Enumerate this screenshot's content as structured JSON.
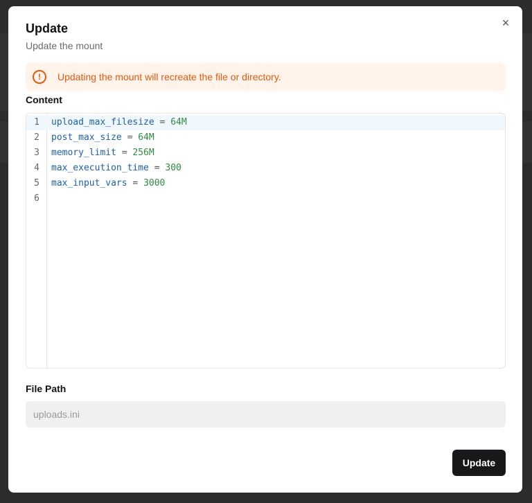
{
  "dialog": {
    "title": "Update",
    "subtitle": "Update the mount",
    "close_icon": "×",
    "alert": {
      "icon": "!",
      "text": "Updating the mount will recreate the file or directory."
    },
    "content_label": "Content",
    "editor": {
      "lines": [
        {
          "n": "1",
          "key": "upload_max_filesize",
          "eq": " = ",
          "val": "64M"
        },
        {
          "n": "2",
          "key": "post_max_size",
          "eq": " = ",
          "val": "64M"
        },
        {
          "n": "3",
          "key": "memory_limit",
          "eq": " = ",
          "val": "256M"
        },
        {
          "n": "4",
          "key": "max_execution_time",
          "eq": " = ",
          "val": "300"
        },
        {
          "n": "5",
          "key": "max_input_vars",
          "eq": " = ",
          "val": "3000"
        },
        {
          "n": "6",
          "key": "",
          "eq": "",
          "val": ""
        }
      ]
    },
    "file_path_label": "File Path",
    "file_path_value": "uploads.ini",
    "update_button": "Update"
  },
  "colors": {
    "accent": "#18181b",
    "warning": "#ea580c",
    "warning_bg": "#fff3ea"
  }
}
